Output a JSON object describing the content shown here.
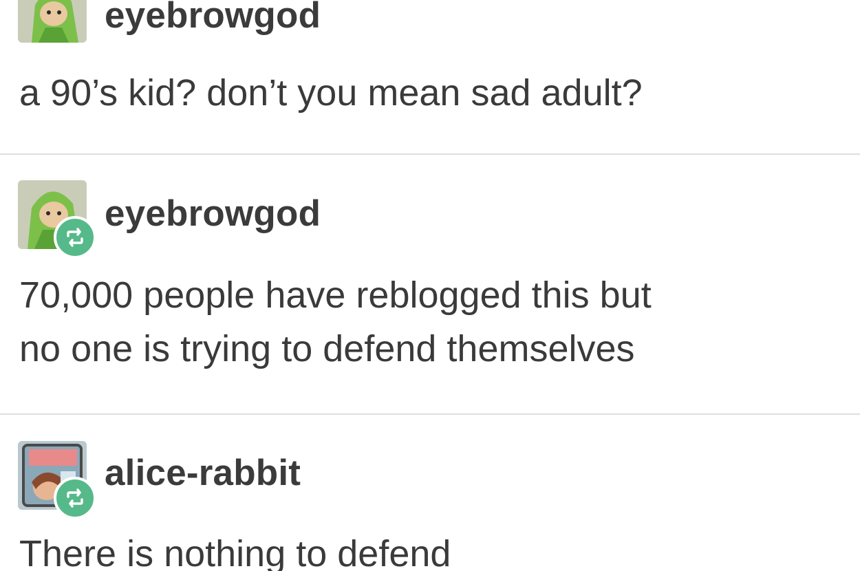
{
  "posts": [
    {
      "username": "eyebrowgod",
      "avatar": "green-hooded-doll-avatar",
      "reblogged": false,
      "lines": [
        "a 90’s kid? don’t you mean sad adult?"
      ]
    },
    {
      "username": "eyebrowgod",
      "avatar": "green-hooded-doll-avatar",
      "reblogged": true,
      "lines": [
        "70,000 people have reblogged this but",
        "no one is trying to defend themselves"
      ]
    },
    {
      "username": "alice-rabbit",
      "avatar": "comic-art-avatar",
      "reblogged": true,
      "lines": [
        "There is nothing to defend"
      ]
    }
  ],
  "colors": {
    "text": "#3a3a3a",
    "reblog_badge": "#56b98a",
    "divider": "#dedede",
    "background": "#ffffff"
  },
  "icons": {
    "reblog": "reblog-icon"
  }
}
